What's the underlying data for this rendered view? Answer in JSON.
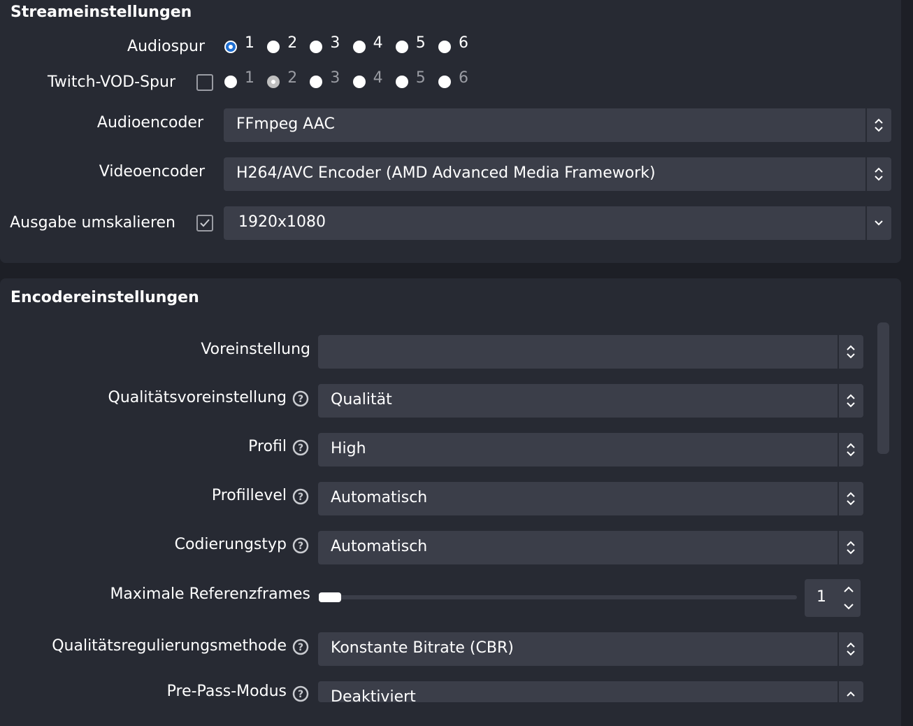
{
  "stream_settings": {
    "title": "Streameinstellungen",
    "audio_track_label": "Audiospur",
    "audio_tracks": [
      "1",
      "2",
      "3",
      "4",
      "5",
      "6"
    ],
    "audio_track_selected": "1",
    "twitch_vod_label": "Twitch-VOD-Spur",
    "twitch_vod_checked": false,
    "twitch_vod_tracks": [
      "1",
      "2",
      "3",
      "4",
      "5",
      "6"
    ],
    "twitch_vod_selected": "2",
    "audio_encoder_label": "Audioencoder",
    "audio_encoder_value": "FFmpeg AAC",
    "video_encoder_label": "Videoencoder",
    "video_encoder_value": "H264/AVC Encoder (AMD Advanced Media Framework)",
    "rescale_label": "Ausgabe umskalieren",
    "rescale_checked": true,
    "rescale_value": "1920x1080"
  },
  "encoder_settings": {
    "title": "Encodereinstellungen",
    "preset_label": "Voreinstellung",
    "preset_value": "",
    "quality_preset_label": "Qualitätsvoreinstellung",
    "quality_preset_value": "Qualität",
    "profile_label": "Profil",
    "profile_value": "High",
    "profile_level_label": "Profillevel",
    "profile_level_value": "Automatisch",
    "coding_type_label": "Codierungstyp",
    "coding_type_value": "Automatisch",
    "max_ref_frames_label": "Maximale Referenzframes",
    "max_ref_frames_value": "1",
    "rate_control_label": "Qualitätsregulierungsmethode",
    "rate_control_value": "Konstante Bitrate (CBR)",
    "prepass_label": "Pre-Pass-Modus",
    "prepass_value": "Deaktiviert"
  },
  "colors": {
    "background": "#1d1f26",
    "panel": "#272a33",
    "field": "#3b3e49",
    "accent": "#1f6fd1"
  },
  "icons": {
    "help": "question-circle-icon",
    "select_arrows": "chevron-updown-icon",
    "dropdown": "chevron-down-icon",
    "check": "checkmark-icon"
  }
}
